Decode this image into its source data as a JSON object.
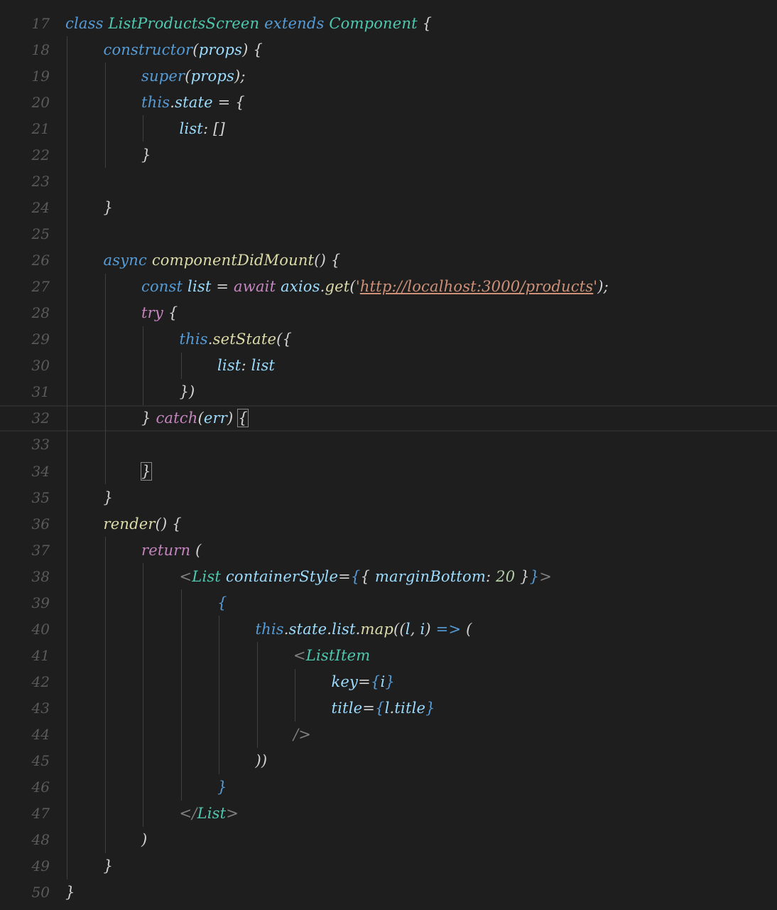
{
  "editor": {
    "lines": [
      {
        "num": "17",
        "indent": 0,
        "tokens": [
          [
            "k",
            "class"
          ],
          [
            "p",
            " "
          ],
          [
            "cls",
            "ListProductsScreen"
          ],
          [
            "p",
            " "
          ],
          [
            "k",
            "extends"
          ],
          [
            "p",
            " "
          ],
          [
            "cls",
            "Component"
          ],
          [
            "p",
            " {"
          ]
        ]
      },
      {
        "num": "18",
        "indent": 1,
        "tokens": [
          [
            "k",
            "constructor"
          ],
          [
            "p",
            "("
          ],
          [
            "v",
            "props"
          ],
          [
            "p",
            ") {"
          ]
        ]
      },
      {
        "num": "19",
        "indent": 2,
        "tokens": [
          [
            "k",
            "super"
          ],
          [
            "p",
            "("
          ],
          [
            "v",
            "props"
          ],
          [
            "p",
            ");"
          ]
        ]
      },
      {
        "num": "20",
        "indent": 2,
        "tokens": [
          [
            "k",
            "this"
          ],
          [
            "p",
            "."
          ],
          [
            "v",
            "state"
          ],
          [
            "p",
            " = {"
          ]
        ]
      },
      {
        "num": "21",
        "indent": 3,
        "tokens": [
          [
            "v",
            "list"
          ],
          [
            "p",
            ": []"
          ]
        ]
      },
      {
        "num": "22",
        "indent": 2,
        "tokens": [
          [
            "p",
            "}"
          ]
        ]
      },
      {
        "num": "23",
        "indent": 0,
        "tokens": []
      },
      {
        "num": "24",
        "indent": 1,
        "tokens": [
          [
            "p",
            "}"
          ]
        ]
      },
      {
        "num": "25",
        "indent": 0,
        "tokens": []
      },
      {
        "num": "26",
        "indent": 1,
        "tokens": [
          [
            "k",
            "async"
          ],
          [
            "p",
            " "
          ],
          [
            "fn",
            "componentDidMount"
          ],
          [
            "p",
            "() {"
          ]
        ]
      },
      {
        "num": "27",
        "indent": 2,
        "tokens": [
          [
            "k",
            "const"
          ],
          [
            "p",
            " "
          ],
          [
            "v",
            "list"
          ],
          [
            "p",
            " = "
          ],
          [
            "kc",
            "await"
          ],
          [
            "p",
            " "
          ],
          [
            "v",
            "axios"
          ],
          [
            "p",
            "."
          ],
          [
            "fn",
            "get"
          ],
          [
            "p",
            "("
          ],
          [
            "s",
            "'"
          ],
          [
            "url",
            "http://localhost:3000/products"
          ],
          [
            "s",
            "'"
          ],
          [
            "p",
            ");"
          ]
        ]
      },
      {
        "num": "28",
        "indent": 2,
        "tokens": [
          [
            "kc",
            "try"
          ],
          [
            "p",
            " {"
          ]
        ]
      },
      {
        "num": "29",
        "indent": 3,
        "tokens": [
          [
            "k",
            "this"
          ],
          [
            "p",
            "."
          ],
          [
            "fn",
            "setState"
          ],
          [
            "p",
            "({"
          ]
        ]
      },
      {
        "num": "30",
        "indent": 4,
        "tokens": [
          [
            "v",
            "list"
          ],
          [
            "p",
            ": "
          ],
          [
            "v",
            "list"
          ]
        ]
      },
      {
        "num": "31",
        "indent": 3,
        "tokens": [
          [
            "p",
            "})"
          ]
        ]
      },
      {
        "num": "32",
        "indent": 2,
        "tokens": [
          [
            "p",
            "} "
          ],
          [
            "kc",
            "catch"
          ],
          [
            "p",
            "("
          ],
          [
            "v",
            "err"
          ],
          [
            "p",
            ") "
          ],
          [
            "hl",
            "{"
          ]
        ]
      },
      {
        "num": "33",
        "indent": 0,
        "tokens": []
      },
      {
        "num": "34",
        "indent": 2,
        "tokens": [
          [
            "hl",
            "}"
          ]
        ]
      },
      {
        "num": "35",
        "indent": 1,
        "tokens": [
          [
            "p",
            "}"
          ]
        ]
      },
      {
        "num": "36",
        "indent": 1,
        "tokens": [
          [
            "fn",
            "render"
          ],
          [
            "p",
            "() {"
          ]
        ]
      },
      {
        "num": "37",
        "indent": 2,
        "tokens": [
          [
            "kc",
            "return"
          ],
          [
            "p",
            " ("
          ]
        ]
      },
      {
        "num": "38",
        "indent": 3,
        "tokens": [
          [
            "tag",
            "<"
          ],
          [
            "tagname",
            "List"
          ],
          [
            "p",
            " "
          ],
          [
            "v",
            "containerStyle"
          ],
          [
            "p",
            "="
          ],
          [
            "k",
            "{"
          ],
          [
            "p",
            "{ "
          ],
          [
            "v",
            "marginBottom"
          ],
          [
            "p",
            ": "
          ],
          [
            "n",
            "20"
          ],
          [
            "p",
            " }"
          ],
          [
            "k",
            "}"
          ],
          [
            "tag",
            ">"
          ]
        ]
      },
      {
        "num": "39",
        "indent": 4,
        "tokens": [
          [
            "k",
            "{"
          ]
        ]
      },
      {
        "num": "40",
        "indent": 5,
        "tokens": [
          [
            "k",
            "this"
          ],
          [
            "p",
            "."
          ],
          [
            "v",
            "state"
          ],
          [
            "p",
            "."
          ],
          [
            "v",
            "list"
          ],
          [
            "p",
            "."
          ],
          [
            "fn",
            "map"
          ],
          [
            "p",
            "(("
          ],
          [
            "v",
            "l"
          ],
          [
            "p",
            ", "
          ],
          [
            "v",
            "i"
          ],
          [
            "p",
            ") "
          ],
          [
            "k",
            "=>"
          ],
          [
            "p",
            " ("
          ]
        ]
      },
      {
        "num": "41",
        "indent": 6,
        "tokens": [
          [
            "tag",
            "<"
          ],
          [
            "tagname",
            "ListItem"
          ]
        ]
      },
      {
        "num": "42",
        "indent": 7,
        "tokens": [
          [
            "v",
            "key"
          ],
          [
            "p",
            "="
          ],
          [
            "k",
            "{"
          ],
          [
            "v",
            "i"
          ],
          [
            "k",
            "}"
          ]
        ]
      },
      {
        "num": "43",
        "indent": 7,
        "tokens": [
          [
            "v",
            "title"
          ],
          [
            "p",
            "="
          ],
          [
            "k",
            "{"
          ],
          [
            "v",
            "l"
          ],
          [
            "p",
            "."
          ],
          [
            "v",
            "title"
          ],
          [
            "k",
            "}"
          ]
        ]
      },
      {
        "num": "44",
        "indent": 6,
        "tokens": [
          [
            "tag",
            "/>"
          ]
        ]
      },
      {
        "num": "45",
        "indent": 5,
        "tokens": [
          [
            "p",
            "))"
          ]
        ]
      },
      {
        "num": "46",
        "indent": 4,
        "tokens": [
          [
            "k",
            "}"
          ]
        ]
      },
      {
        "num": "47",
        "indent": 3,
        "tokens": [
          [
            "tag",
            "</"
          ],
          [
            "tagname",
            "List"
          ],
          [
            "tag",
            ">"
          ]
        ]
      },
      {
        "num": "48",
        "indent": 2,
        "tokens": [
          [
            "p",
            ")"
          ]
        ]
      },
      {
        "num": "49",
        "indent": 1,
        "tokens": [
          [
            "p",
            "}"
          ]
        ]
      },
      {
        "num": "50",
        "indent": 0,
        "tokens": [
          [
            "p",
            "}"
          ]
        ]
      }
    ],
    "current_line": "32",
    "colors": {
      "background": "#1e1e1e",
      "keyword": "#569cd6",
      "control": "#c586c0",
      "class": "#4ec9b0",
      "function": "#dcdcaa",
      "variable": "#9cdcfe",
      "number": "#b5cea8",
      "string": "#ce9178"
    }
  }
}
